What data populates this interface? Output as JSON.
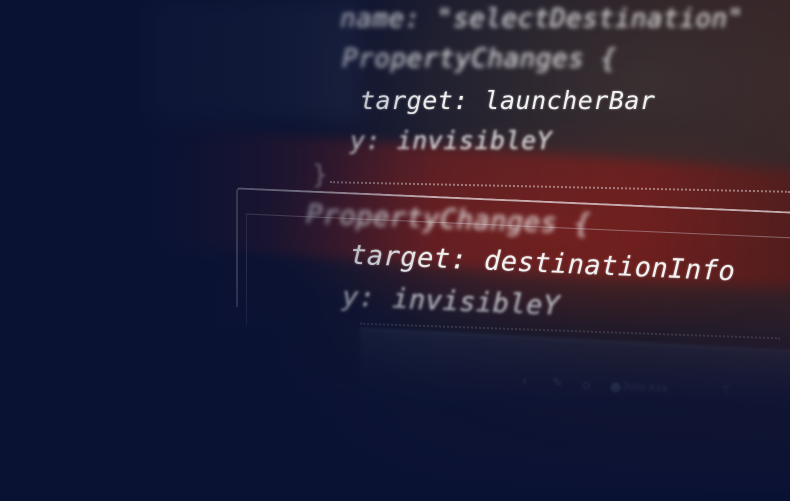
{
  "code": {
    "line1": "name: \"selectDestination\"",
    "line2": "PropertyChanges {",
    "line3": "target: launcherBar",
    "line4": "y: invisibleY",
    "line5": "PropertyChanges {",
    "line6": "target: destinationInfo",
    "line7": "y: invisibleY"
  },
  "bottom_bar": {
    "user_label": "John Kirk"
  },
  "colors": {
    "background": "#0b1230",
    "highlight_band": "#82201e",
    "code_text": "#f2f2f2"
  },
  "icons": [
    "back-icon",
    "edit-icon",
    "home-icon",
    "user-icon",
    "pin-icon"
  ]
}
